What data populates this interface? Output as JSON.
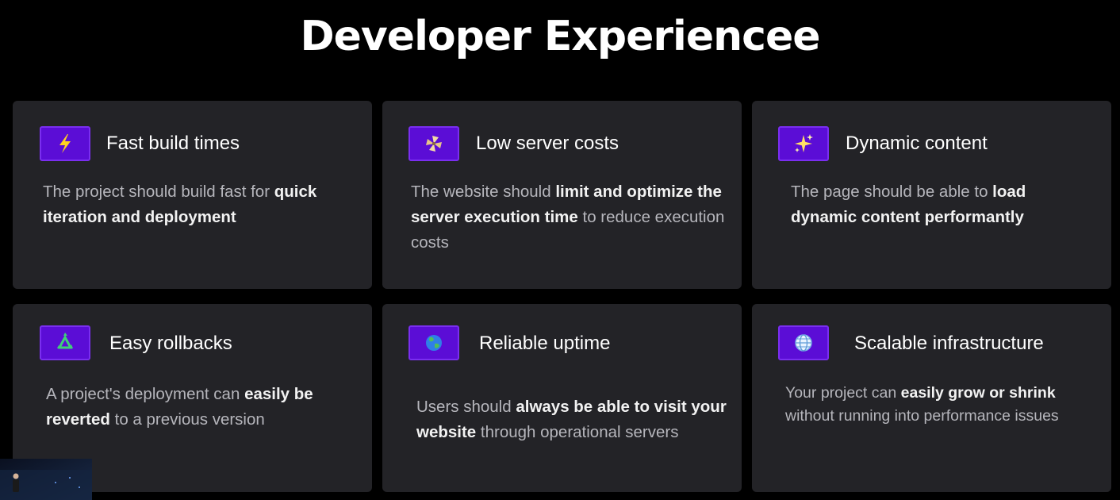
{
  "title": "Developer Experiencee",
  "cards": [
    {
      "icon": "lightning-icon",
      "title": "Fast build times",
      "desc_before": "The project should build fast for ",
      "desc_bold": "quick iteration and deployment",
      "desc_after": ""
    },
    {
      "icon": "pinwheel-icon",
      "title": "Low server costs",
      "desc_before": "The website should ",
      "desc_bold": "limit and optimize the server execution time",
      "desc_after": " to reduce execution costs"
    },
    {
      "icon": "sparkles-icon",
      "title": "Dynamic content",
      "desc_before": "The page should be able to ",
      "desc_bold": "load dynamic content performantly",
      "desc_after": ""
    },
    {
      "icon": "recycle-icon",
      "title": "Easy rollbacks",
      "desc_before": "A project's deployment can ",
      "desc_bold": "easily be reverted",
      "desc_after": " to a previous version"
    },
    {
      "icon": "earth-globe-icon",
      "title": "Reliable uptime",
      "desc_before": "Users should ",
      "desc_bold": "always be able to visit your website",
      "desc_after": " through operational servers"
    },
    {
      "icon": "globe-meridians-icon",
      "title": "Scalable infrastructure",
      "desc_before": "Your project can ",
      "desc_bold": "easily grow or shrink",
      "desc_after": " without running into performance issues"
    }
  ],
  "colors": {
    "background": "#000000",
    "card": "#232327",
    "icon_box": "#5b0dd6",
    "text_body": "#b6b6bc",
    "text_emphasis": "#f2f2f2"
  }
}
